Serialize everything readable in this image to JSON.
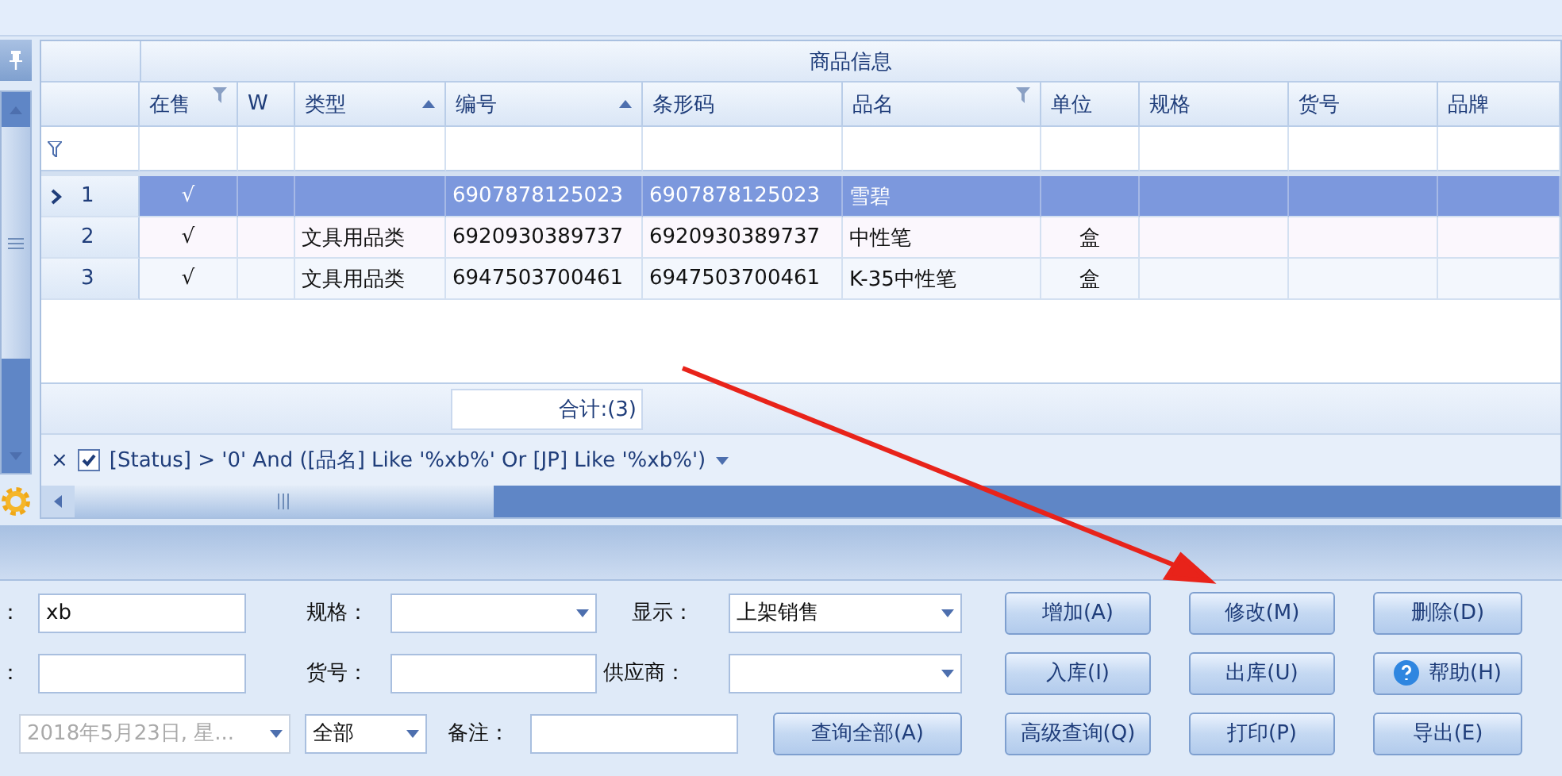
{
  "grid": {
    "band": "商品信息",
    "columns": [
      {
        "label": "在售",
        "filter": true
      },
      {
        "label": "W"
      },
      {
        "label": "类型",
        "sorted": true
      },
      {
        "label": "编号",
        "sorted": true
      },
      {
        "label": "条形码"
      },
      {
        "label": "品名",
        "filter": true
      },
      {
        "label": "单位"
      },
      {
        "label": "规格"
      },
      {
        "label": "货号"
      },
      {
        "label": "品牌"
      }
    ],
    "rows": [
      {
        "number": "1",
        "selected": true,
        "cells": [
          "√",
          null,
          null,
          "6907878125023",
          "6907878125023",
          "雪碧",
          null,
          null,
          null,
          null
        ]
      },
      {
        "number": "2",
        "selected": false,
        "cells": [
          "√",
          null,
          "文具用品类",
          "6920930389737",
          "6920930389737",
          "中性笔",
          "盒",
          null,
          null,
          null
        ]
      },
      {
        "number": "3",
        "selected": false,
        "cells": [
          "√",
          null,
          "文具用品类",
          "6947503700461",
          "6947503700461",
          "K-35中性笔",
          "盒",
          null,
          null,
          null
        ]
      }
    ],
    "summary": "合计:(3)",
    "filter": {
      "close": "×",
      "checked": true,
      "expression": "[Status] > '0' And ([品名] Like '%xb%' Or [JP] Like '%xb%')"
    }
  },
  "form": [
    [
      {
        "kind": "label",
        "text": "："
      },
      {
        "kind": "input",
        "value": "xb"
      },
      {
        "kind": "label",
        "text": "规格："
      },
      {
        "kind": "combo"
      },
      {
        "kind": "label",
        "text": "显示："
      },
      {
        "kind": "combo",
        "value": "上架销售"
      },
      {
        "kind": "button",
        "text": "增加(A)"
      },
      {
        "kind": "button",
        "text": "修改(M)"
      },
      {
        "kind": "button",
        "text": "删除(D)"
      }
    ],
    [
      {
        "kind": "label",
        "text": "："
      },
      {
        "kind": "input"
      },
      {
        "kind": "label",
        "text": "货号："
      },
      {
        "kind": "input"
      },
      {
        "kind": "label",
        "text": "供应商："
      },
      {
        "kind": "combo"
      },
      {
        "kind": "button",
        "text": "入库(I)"
      },
      {
        "kind": "button",
        "text": "出库(U)"
      },
      {
        "kind": "help-button",
        "text": "帮助(H)"
      }
    ],
    [
      {
        "kind": "combo",
        "value": "2018年5月23日, 星...",
        "disabled": true
      },
      {
        "kind": "combo",
        "value": "全部"
      },
      {
        "kind": "label",
        "text": "备注："
      },
      {
        "kind": "input"
      },
      {
        "kind": "button",
        "text": "查询全部(A)"
      },
      {
        "kind": "button",
        "text": "高级查询(Q)"
      },
      {
        "kind": "button",
        "text": "打印(P)"
      },
      {
        "kind": "button",
        "text": "导出(E)"
      }
    ]
  ]
}
